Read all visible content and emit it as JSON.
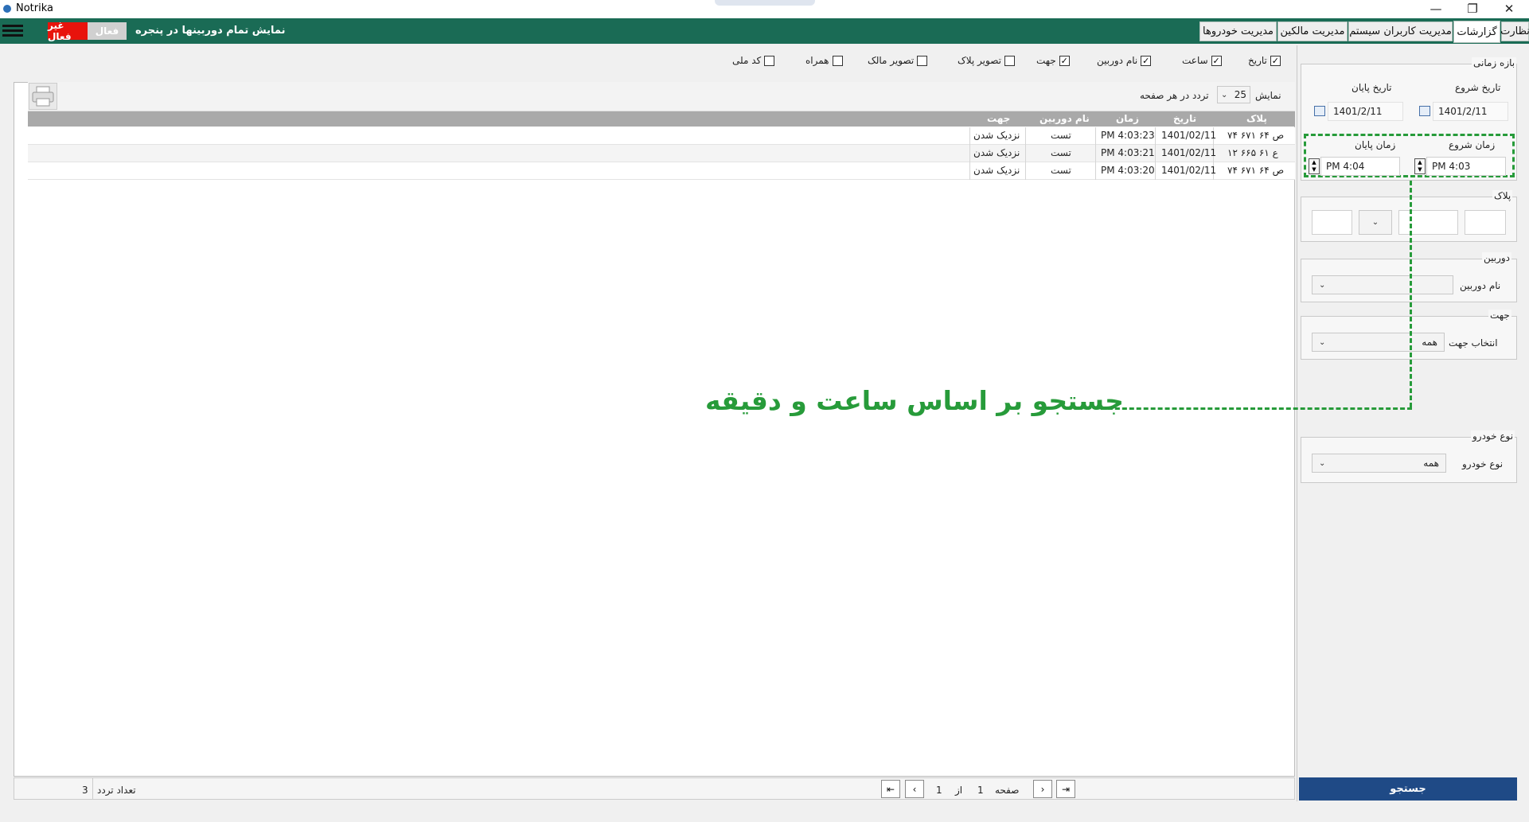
{
  "window": {
    "title": "Notrika",
    "btn_min": "—",
    "btn_max": "❐",
    "btn_close": "✕"
  },
  "topbar": {
    "tabs": [
      "نظارت",
      "گزارشات",
      "مدیریت کاربران سیستم",
      "مدیریت مالکین",
      "مدیریت خودروها"
    ],
    "show_all_label": "نمایش تمام دوربینها در پنجره",
    "active_label": "فعال",
    "inactive_label": "غیر فعال"
  },
  "filters": {
    "time_range": {
      "legend": "بازه زمانی",
      "start_date_label": "تاریخ شروع",
      "start_date": "1401/2/11",
      "end_date_label": "تاریخ پایان",
      "end_date": "1401/2/11",
      "start_time_label": "زمان شروع",
      "start_time": "PM 4:03",
      "end_time_label": "زمان پایان",
      "end_time": "PM 4:04"
    },
    "plate": {
      "legend": "پلاک"
    },
    "camera": {
      "legend": "دوربین",
      "name_label": "نام دوربین",
      "value": ""
    },
    "direction": {
      "legend": "جهت",
      "select_label": "انتخاب جهت",
      "value": "همه"
    },
    "vehicle_type": {
      "legend": "نوع خودرو",
      "label": "نوع خودرو",
      "value": "همه"
    },
    "search_button": "جستجو"
  },
  "columns_toggle": [
    {
      "label": "تاریخ",
      "checked": true
    },
    {
      "label": "ساعت",
      "checked": true
    },
    {
      "label": "نام دوربین",
      "checked": true
    },
    {
      "label": "جهت",
      "checked": true
    },
    {
      "label": "تصویر پلاک",
      "checked": false
    },
    {
      "label": "تصویر مالک",
      "checked": false
    },
    {
      "label": "همراه",
      "checked": false
    },
    {
      "label": "کد ملی",
      "checked": false
    }
  ],
  "toolbar": {
    "show_label": "نمایش",
    "page_size": "25",
    "per_page_label": "تردد در هر صفحه"
  },
  "table": {
    "headers": [
      "پلاک",
      "تاریخ",
      "زمان",
      "نام دوربین",
      "جهت"
    ],
    "rows": [
      [
        "۷۴ ۶۷۱ ص ۶۴",
        "1401/02/11",
        "PM 4:03:23",
        "تست",
        "نزدیک شدن"
      ],
      [
        "۱۲ ۶۶۵ ع ۶۱",
        "1401/02/11",
        "PM 4:03:21",
        "تست",
        "نزدیک شدن"
      ],
      [
        "۷۴ ۶۷۱ ص ۶۴",
        "1401/02/11",
        "PM 4:03:20",
        "تست",
        "نزدیک شدن"
      ]
    ]
  },
  "pager": {
    "page_label": "صفحه",
    "page": "1",
    "of_label": "از",
    "total_pages": "1",
    "count_label": "تعداد تردد",
    "count": "3"
  },
  "annotation": {
    "text": "جستجو بر اساس ساعت و دقیقه",
    "color": "#279b3a"
  },
  "colors": {
    "brand_green": "#1a6b55",
    "search_blue": "#1f4a86",
    "inactive_red": "#e8130c"
  }
}
